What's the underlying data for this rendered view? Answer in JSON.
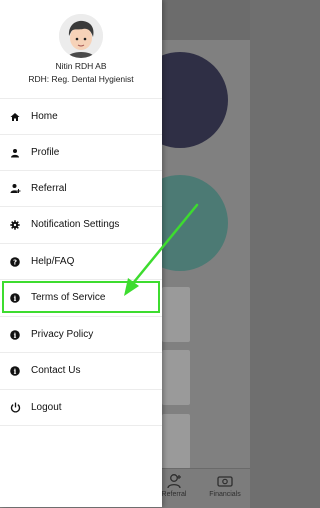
{
  "profile": {
    "name": "Nitin RDH AB",
    "role": "RDH: Reg. Dental Hygienist"
  },
  "menu": [
    {
      "label": "Home",
      "icon": "home-icon"
    },
    {
      "label": "Profile",
      "icon": "person-icon"
    },
    {
      "label": "Referral",
      "icon": "user-plus-icon"
    },
    {
      "label": "Notification Settings",
      "icon": "gear-icon"
    },
    {
      "label": "Help/FAQ",
      "icon": "question-circle-icon"
    },
    {
      "label": "Terms of Service",
      "icon": "info-circle-icon"
    },
    {
      "label": "Privacy Policy",
      "icon": "info-circle-icon"
    },
    {
      "label": "Contact Us",
      "icon": "info-circle-icon"
    },
    {
      "label": "Logout",
      "icon": "power-icon"
    }
  ],
  "bottom_tabs": [
    {
      "label": "Referral",
      "icon": "user-plus-icon"
    },
    {
      "label": "Financials",
      "icon": "money-icon"
    }
  ],
  "colors": {
    "highlight": "#3ddc2f"
  }
}
